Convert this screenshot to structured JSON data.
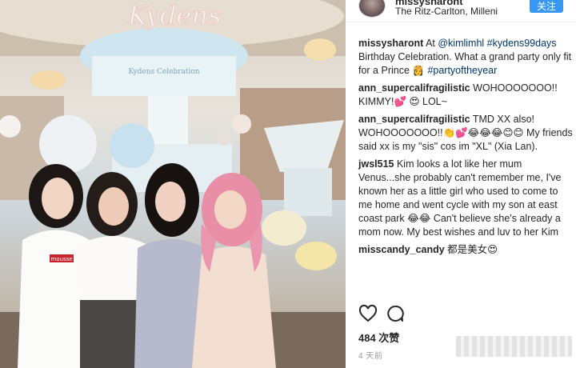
{
  "header": {
    "username": "missysharont",
    "location": "The Ritz-Carlton, Milleni",
    "follow_label": "关注"
  },
  "photo": {
    "sign_text": "Kydens",
    "canopy_text": "Kydens Celebration",
    "tag_text": "mousse"
  },
  "comments": [
    {
      "user": "missysharont",
      "segments": [
        {
          "type": "text",
          "text": " At "
        },
        {
          "type": "mention",
          "text": "@kimlimhl"
        },
        {
          "type": "text",
          "text": " "
        },
        {
          "type": "mention",
          "text": "#kydens99days"
        },
        {
          "type": "text",
          "text": " Birthday Celebration. What a grand party only fit for a Prince 👸 "
        },
        {
          "type": "mention",
          "text": "#partyoftheyear"
        }
      ]
    },
    {
      "user": "ann_supercalifragilistic",
      "segments": [
        {
          "type": "text",
          "text": " WOHOOOOOOO!! KIMMY!💕 😍 LOL~"
        }
      ]
    },
    {
      "user": "ann_supercalifragilistic",
      "segments": [
        {
          "type": "text",
          "text": " TMD XX also! WOHOOOOOOO!!👏💕😂😂😂😊😊 My friends said xx is my \"sis\" cos im \"XL\" (Xia Lan)."
        }
      ]
    },
    {
      "user": "jwsl515",
      "segments": [
        {
          "type": "text",
          "text": " Kim looks a lot like her mum Venus...she probably can't remember me, I've known her as a little girl who used to come to me home and went cycle with my son at east coast park 😂😂 Can't believe she's already a mom now. My best wishes and luv to her Kim"
        }
      ]
    },
    {
      "user": "misscandy_candy",
      "segments": [
        {
          "type": "text",
          "text": " 都是美女😍"
        }
      ]
    }
  ],
  "actions": {
    "like_icon": "heart-outline-icon",
    "comment_icon": "comment-bubble-icon"
  },
  "likes_text": "484 次赞",
  "timestamp": "4 天前",
  "colors": {
    "follow_button": "#3897f0",
    "mention": "#003569",
    "text": "#262626"
  }
}
